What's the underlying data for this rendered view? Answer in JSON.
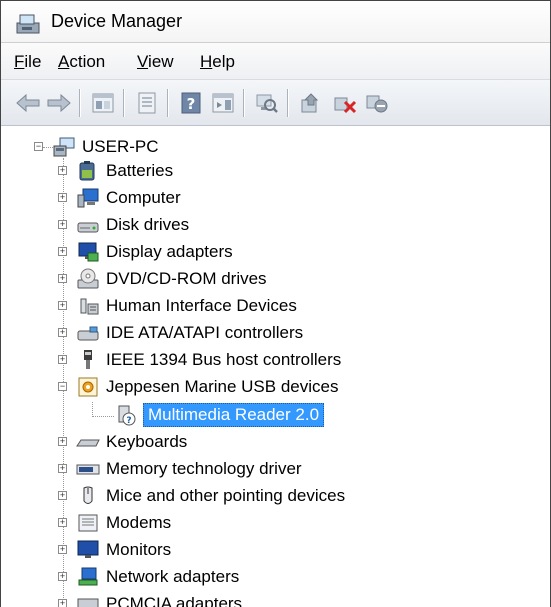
{
  "window": {
    "title": "Device Manager"
  },
  "menu": [
    {
      "label": "File",
      "underline": "F",
      "rest": "ile"
    },
    {
      "label": "Action",
      "underline": "A",
      "rest": "ction"
    },
    {
      "label": "View",
      "underline": "V",
      "rest": "iew"
    },
    {
      "label": "Help",
      "underline": "H",
      "rest": "elp"
    }
  ],
  "toolbar": {
    "buttons": [
      "back-arrow-icon",
      "forward-arrow-icon",
      "show-hide-tree-icon",
      "properties-icon",
      "help-icon",
      "action-pane-icon",
      "scan-hardware-icon",
      "update-driver-icon",
      "uninstall-icon",
      "disable-device-icon"
    ]
  },
  "tree": {
    "root": "USER-PC",
    "categories": [
      {
        "label": "Batteries",
        "icon": "battery-icon"
      },
      {
        "label": "Computer",
        "icon": "computer-icon"
      },
      {
        "label": "Disk drives",
        "icon": "disk-drive-icon"
      },
      {
        "label": "Display adapters",
        "icon": "display-adapter-icon"
      },
      {
        "label": "DVD/CD-ROM drives",
        "icon": "dvd-drive-icon"
      },
      {
        "label": "Human Interface Devices",
        "icon": "hid-icon"
      },
      {
        "label": "IDE ATA/ATAPI controllers",
        "icon": "ide-controller-icon"
      },
      {
        "label": "IEEE 1394 Bus host controllers",
        "icon": "firewire-icon"
      },
      {
        "label": "Jeppesen Marine USB devices",
        "icon": "usb-device-category-icon",
        "expanded": true,
        "children": [
          {
            "label": "Multimedia Reader 2.0",
            "icon": "unknown-device-icon",
            "selected": true
          }
        ]
      },
      {
        "label": "Keyboards",
        "icon": "keyboard-icon"
      },
      {
        "label": "Memory technology driver",
        "icon": "memory-icon"
      },
      {
        "label": "Mice and other pointing devices",
        "icon": "mouse-icon"
      },
      {
        "label": "Modems",
        "icon": "modem-icon"
      },
      {
        "label": "Monitors",
        "icon": "monitor-icon"
      },
      {
        "label": "Network adapters",
        "icon": "network-adapter-icon"
      },
      {
        "label": "PCMCIA adapters",
        "icon": "pcmcia-icon"
      }
    ]
  },
  "colors": {
    "selection": "#3399ff",
    "toolbar": "#e3e7ed"
  }
}
